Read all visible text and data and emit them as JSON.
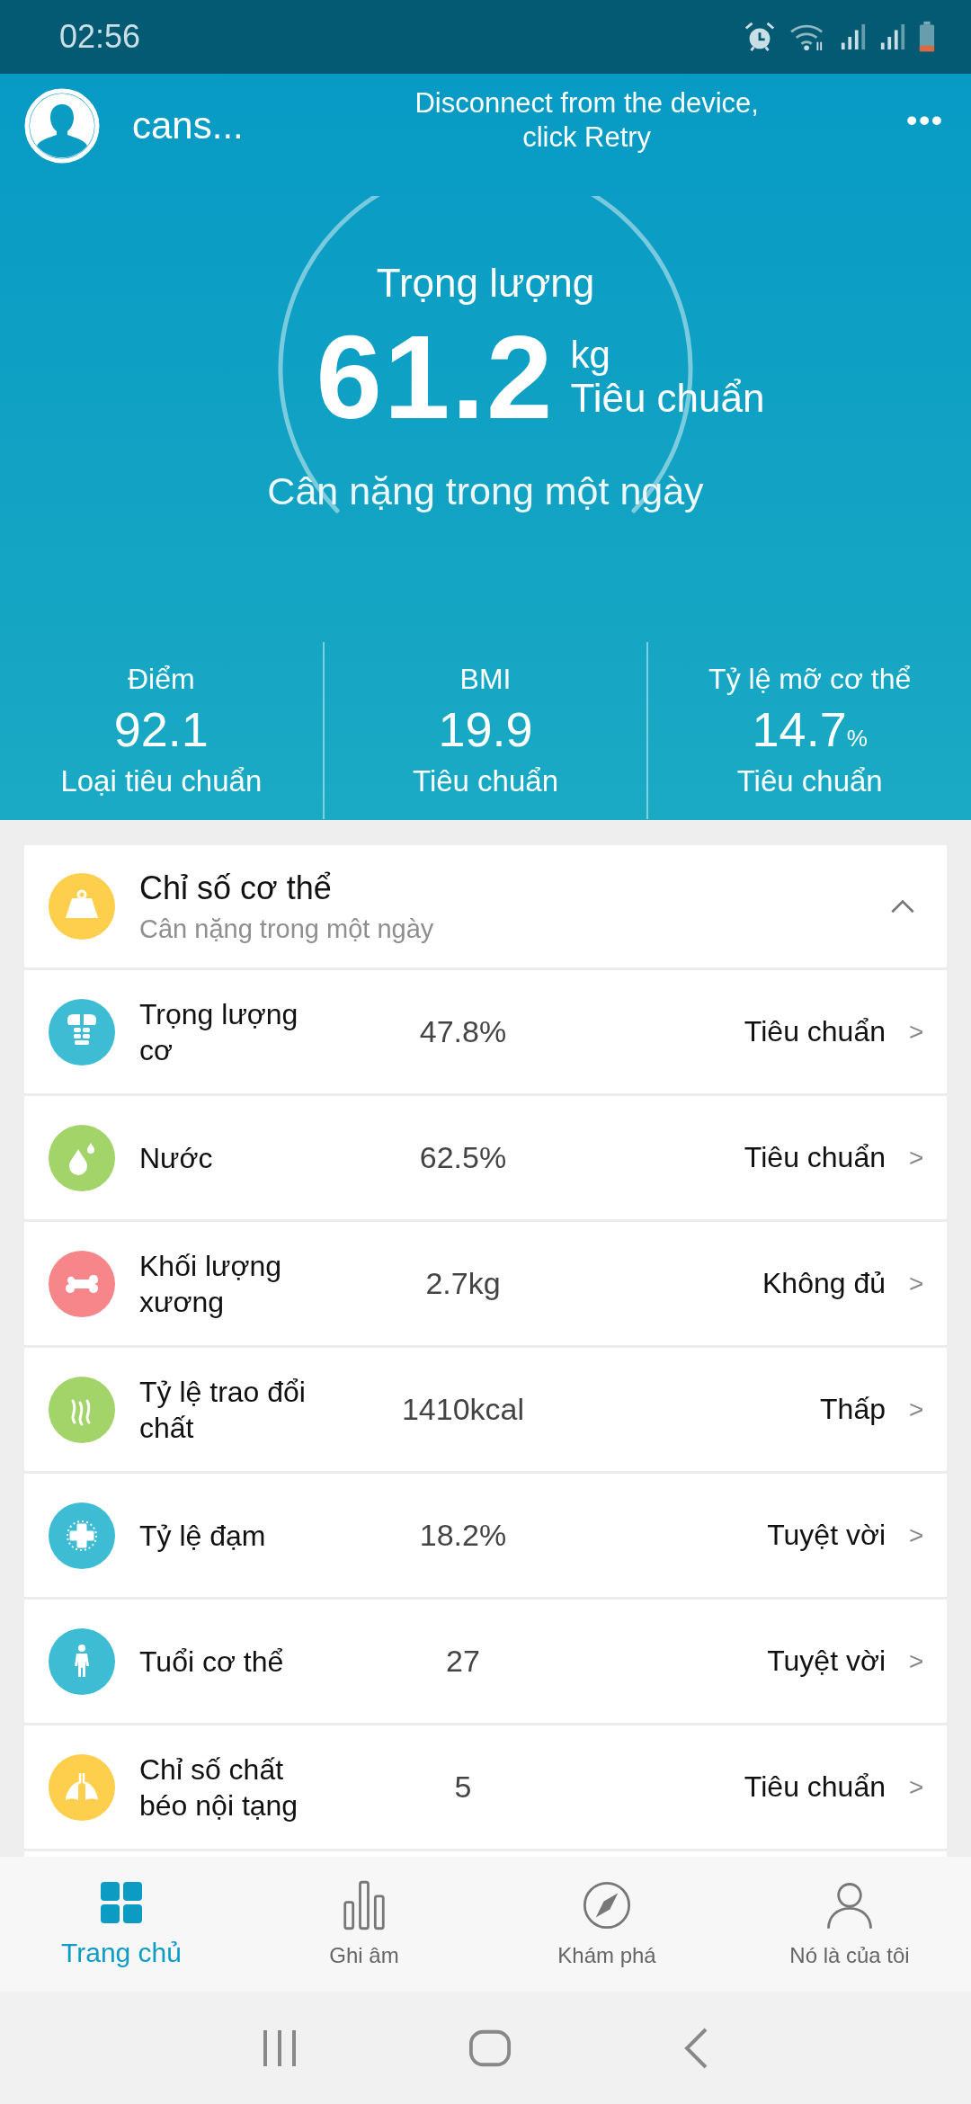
{
  "status_bar": {
    "time": "02:56"
  },
  "header": {
    "user_name": "cans...",
    "message": "Disconnect from the device,\nclick Retry",
    "more": "•••"
  },
  "gauge": {
    "title": "Trọng lượng",
    "value": "61.2",
    "unit": "kg",
    "rating": "Tiêu chuẩn",
    "subtitle": "Cân nặng trong một ngày"
  },
  "summary": [
    {
      "label": "Điểm",
      "value": "92.1",
      "rating": "Loại tiêu chuẩn"
    },
    {
      "label": "BMI",
      "value": "19.9",
      "rating": "Tiêu chuẩn"
    },
    {
      "label": "Tỷ lệ mỡ cơ thể",
      "value": "14.7",
      "unit": "%",
      "rating": "Tiêu chuẩn"
    }
  ],
  "body_metrics": {
    "title": "Chỉ số cơ thể",
    "subtitle": "Cân nặng trong một ngày",
    "expanded": true,
    "rows": [
      {
        "kind": "muscle",
        "color": "#3dbcd4",
        "name": "Trọng lượng\ncơ",
        "value": "47.8%",
        "rating": "Tiêu chuẩn",
        "chevron": ">"
      },
      {
        "kind": "water",
        "color": "#a2d46a",
        "name": "Nước",
        "value": "62.5%",
        "rating": "Tiêu chuẩn",
        "chevron": ">"
      },
      {
        "kind": "bone",
        "color": "#f7868a",
        "name": "Khối lượng\nxương",
        "value": "2.7kg",
        "rating": "Không đủ",
        "chevron": ">"
      },
      {
        "kind": "metabolism",
        "color": "#a2d46a",
        "name": "Tỷ lệ trao đổi\nchất",
        "value": "1410kcal",
        "rating": "Thấp",
        "chevron": ">"
      },
      {
        "kind": "protein",
        "color": "#3dbcd4",
        "name": "Tỷ lệ đạm",
        "value": "18.2%",
        "rating": "Tuyệt vời",
        "chevron": ">"
      },
      {
        "kind": "body-age",
        "color": "#3dbcd4",
        "name": "Tuổi cơ thể",
        "value": "27",
        "rating": "Tuyệt vời",
        "chevron": ">"
      },
      {
        "kind": "visceral-fat",
        "color": "#fecf4c",
        "name": "Chỉ số chất\nbéo nội tạng",
        "value": "5",
        "rating": "Tiêu chuẩn",
        "chevron": ">"
      }
    ]
  },
  "tabs": [
    {
      "kind": "home",
      "label": "Trang chủ",
      "selected": true
    },
    {
      "kind": "records",
      "label": "Ghi âm",
      "selected": false
    },
    {
      "kind": "discover",
      "label": "Khám phá",
      "selected": false
    },
    {
      "kind": "me",
      "label": "Nó là của tôi",
      "selected": false
    }
  ]
}
